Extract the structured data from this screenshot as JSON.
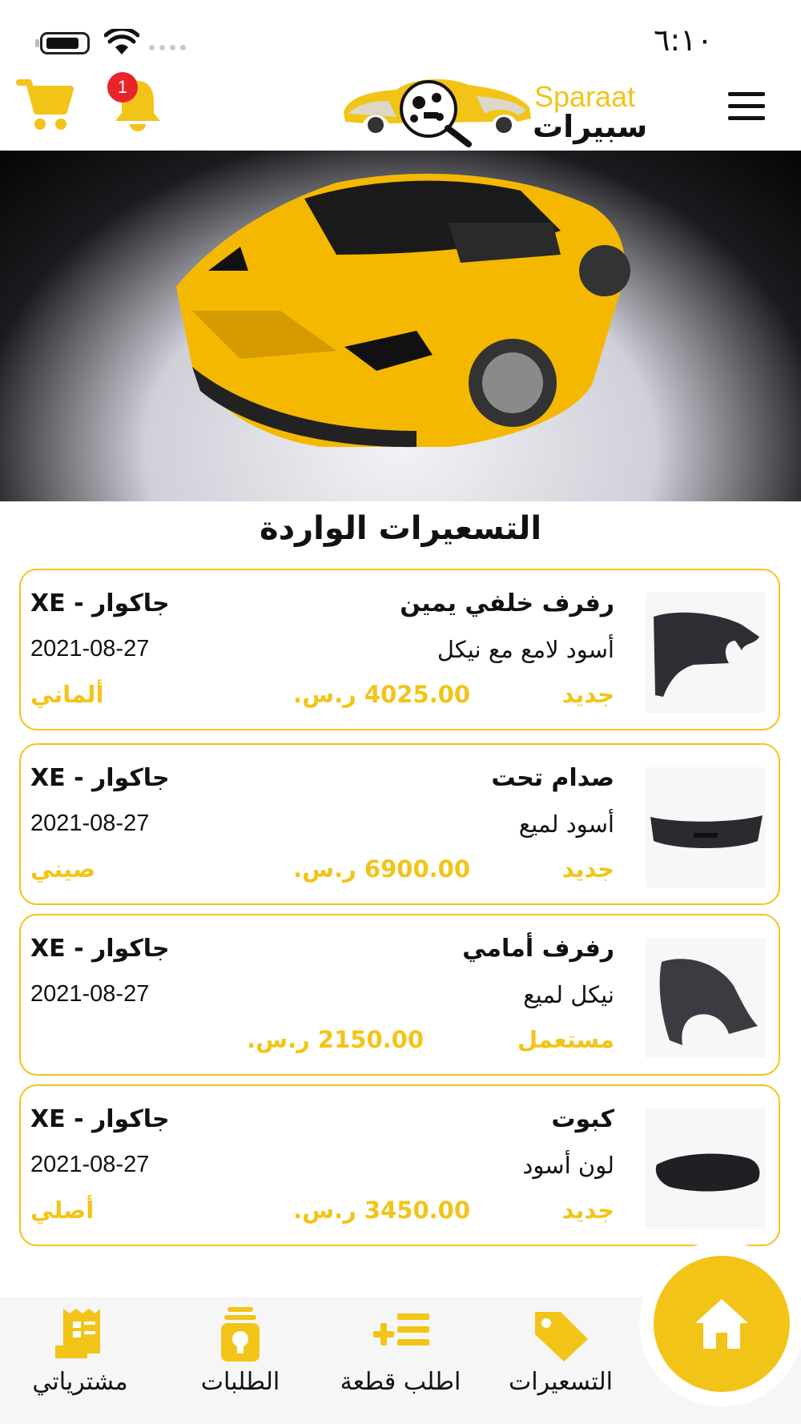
{
  "status_bar": {
    "time": "٦:١٠"
  },
  "header": {
    "notification_count": "1",
    "logo_text_en": "Sparaat",
    "logo_text_ar": "سبيرات"
  },
  "section_title": "التسعيرات الواردة",
  "currency": "ر.س.",
  "quotes": [
    {
      "part": "رفرف خلفي يمين",
      "description": "أسود لامع مع نيكل",
      "condition": "جديد",
      "price": "4025.00 ر.س.",
      "car": "جاكوار - XE",
      "date": "2021-08-27",
      "origin": "ألماني",
      "thumb": "rear-fender-image"
    },
    {
      "part": "صدام تحت",
      "description": "أسود لميع",
      "condition": "جديد",
      "price": "6900.00 ر.س.",
      "car": "جاكوار - XE",
      "date": "2021-08-27",
      "origin": "صيني",
      "thumb": "bumper-image"
    },
    {
      "part": "رفرف أمامي",
      "description": "نيكل لميع",
      "condition": "مستعمل",
      "price": "2150.00 ر.س.",
      "car": "جاكوار - XE",
      "date": "2021-08-27",
      "origin": "",
      "thumb": "front-fender-image"
    },
    {
      "part": "كبوت",
      "description": "لون أسود",
      "condition": "جديد",
      "price": "3450.00 ر.س.",
      "car": "جاكوار - XE",
      "date": "2021-08-27",
      "origin": "أصلي",
      "thumb": "hood-image"
    }
  ],
  "bottom_nav": {
    "purchases": "مشترياتي",
    "requests": "الطلبات",
    "request_part": "اطلب قطعة",
    "quotes": "التسعيرات"
  },
  "colors": {
    "accent": "#f2c418",
    "badge": "#e8232a"
  },
  "icons": [
    "cart-icon",
    "bell-icon",
    "menu-icon",
    "receipt-icon",
    "bulb-icon",
    "add-list-icon",
    "tag-icon",
    "home-icon"
  ]
}
